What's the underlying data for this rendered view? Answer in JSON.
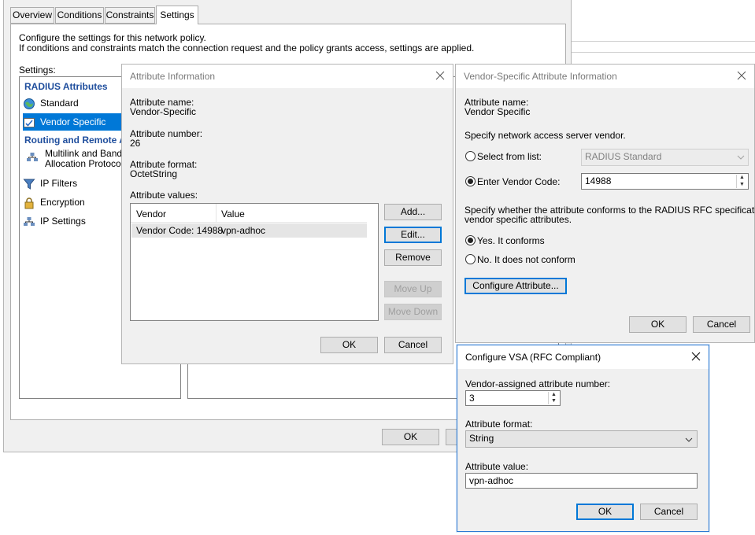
{
  "policy_window": {
    "tabs": [
      "Overview",
      "Conditions",
      "Constraints",
      "Settings"
    ],
    "active_tab": "Settings",
    "intro_line1": "Configure the settings for this network policy.",
    "intro_line2": "If conditions and constraints match the connection request and the policy grants access, settings are applied.",
    "settings_label": "Settings:",
    "radius_header": "RADIUS Attributes",
    "standard": "Standard",
    "vendor_specific": "Vendor Specific",
    "routing_header": "Routing and Remote A",
    "multilink_line1": "Multilink and Bandwid",
    "multilink_line2": "Allocation Protocol (E",
    "ip_filters": "IP Filters",
    "encryption": "Encryption",
    "ip_settings": "IP Settings",
    "ok": "OK"
  },
  "attr_info": {
    "title": "Attribute Information",
    "name_label": "Attribute name:",
    "name_value": "Vendor-Specific",
    "number_label": "Attribute number:",
    "number_value": "26",
    "format_label": "Attribute format:",
    "format_value": "OctetString",
    "values_label": "Attribute values:",
    "col_vendor": "Vendor",
    "col_value": "Value",
    "row_vendor": "Vendor Code: 14988",
    "row_value": "vpn-adhoc",
    "add": "Add...",
    "edit": "Edit...",
    "remove": "Remove",
    "move_up": "Move Up",
    "move_down": "Move Down",
    "ok": "OK",
    "cancel": "Cancel"
  },
  "vsa_info": {
    "title": "Vendor-Specific Attribute Information",
    "name_label": "Attribute name:",
    "name_value": "Vendor Specific",
    "specify_label": "Specify network access server vendor.",
    "select_from_list": "Select from list:",
    "select_value": "RADIUS Standard",
    "enter_vendor_code": "Enter Vendor Code:",
    "vendor_code": "14988",
    "conform_line1": "Specify whether the attribute conforms to the RADIUS RFC specification for",
    "conform_line2": "vendor specific attributes.",
    "yes_conforms": "Yes. It conforms",
    "no_conforms": "No. It does not conform",
    "configure_attr": "Configure Attribute...",
    "ok": "OK",
    "cancel": "Cancel"
  },
  "configure_vsa": {
    "title": "Configure VSA (RFC Compliant)",
    "number_label": "Vendor-assigned attribute number:",
    "number_value": "3",
    "format_label": "Attribute format:",
    "format_value": "String",
    "value_label": "Attribute value:",
    "value_value": "vpn-adhoc",
    "ok": "OK",
    "cancel": "Cancel"
  },
  "colors": {
    "selection": "#0078d7",
    "section_header": "#1f4e9d",
    "window_bg": "#f0f0f0"
  }
}
